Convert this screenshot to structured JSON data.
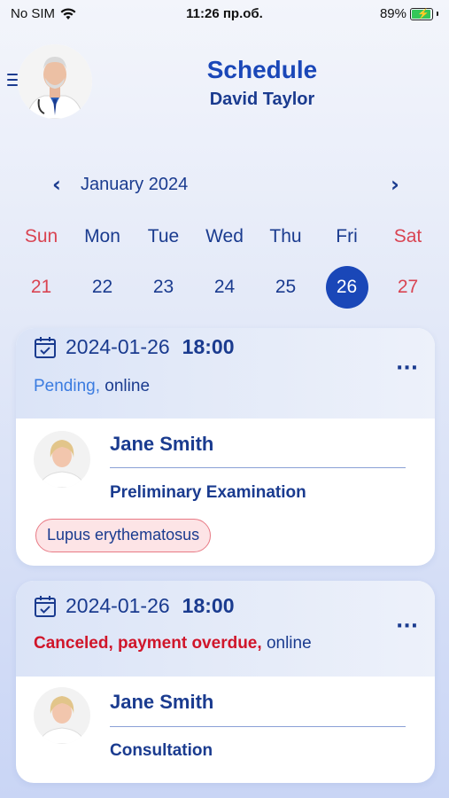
{
  "status_bar": {
    "carrier": "No SIM",
    "time": "11:26 пр.об.",
    "battery": "89%"
  },
  "header": {
    "title": "Schedule",
    "doctor_name": "David Taylor"
  },
  "calendar": {
    "month": "January 2024",
    "weekdays": [
      "Sun",
      "Mon",
      "Tue",
      "Wed",
      "Thu",
      "Fri",
      "Sat"
    ],
    "days": [
      "21",
      "22",
      "23",
      "24",
      "25",
      "26",
      "27"
    ],
    "selected_day": "26"
  },
  "appointments": [
    {
      "date": "2024-01-26",
      "time": "18:00",
      "status": "Pending,",
      "mode": "online",
      "patient": "Jane Smith",
      "visit_type": "Preliminary Examination",
      "diagnosis": "Lupus erythematosus"
    },
    {
      "date": "2024-01-26",
      "time": "18:00",
      "status": "Canceled, payment overdue,",
      "mode": "online",
      "patient": "Jane Smith",
      "visit_type": "Consultation"
    }
  ],
  "colors": {
    "primary": "#1a47b8",
    "text": "#1a3b8f",
    "weekend": "#d94452",
    "canceled": "#d0152a",
    "pending": "#3a7be0"
  }
}
